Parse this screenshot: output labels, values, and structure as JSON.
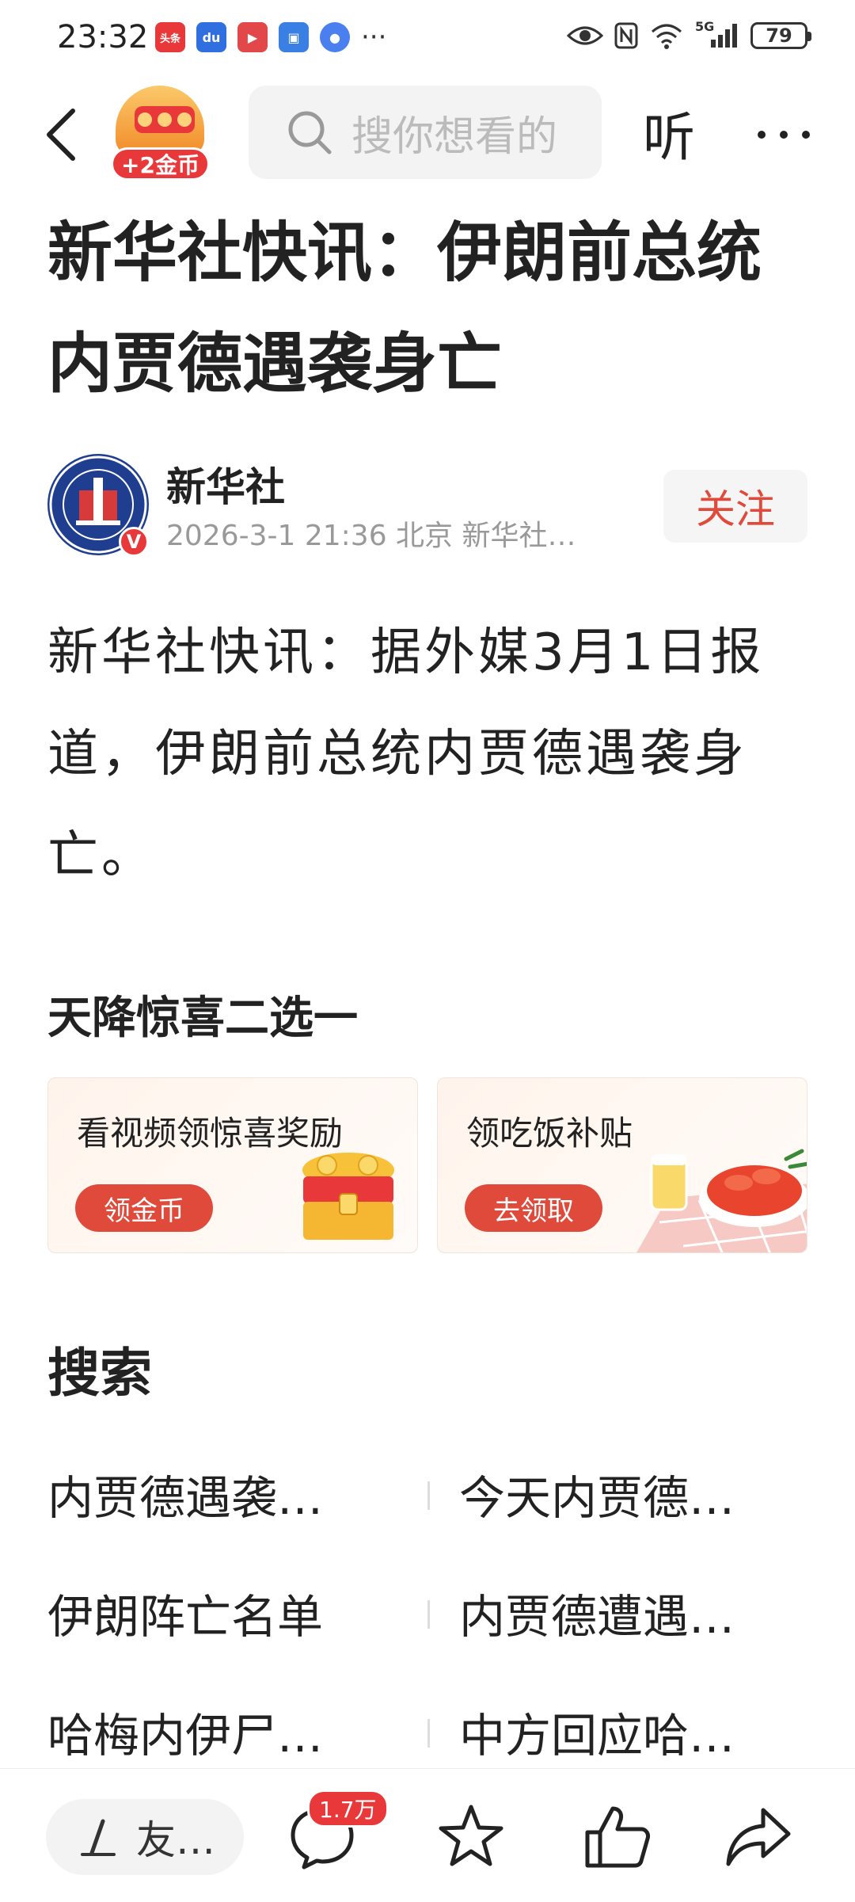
{
  "status_bar": {
    "time": "23:32",
    "app_icons": [
      {
        "name": "toutiao-icon",
        "label": "头条",
        "color": "#e8383a"
      },
      {
        "name": "baidu-icon",
        "label": "du",
        "color": "#2f6fe0"
      },
      {
        "name": "video-icon",
        "label": "▶",
        "color": "#e2484a"
      },
      {
        "name": "phone-icon",
        "label": "▣",
        "color": "#3a7fe4"
      },
      {
        "name": "app-icon",
        "label": "●",
        "color": "#4a7ff0"
      }
    ],
    "more": "···",
    "network": "5G",
    "battery": "79"
  },
  "nav": {
    "coin_badge": "+2金币",
    "search_placeholder": "搜你想看的",
    "listen_label": "听"
  },
  "article": {
    "title": "新华社快讯：伊朗前总统内贾德遇袭身亡",
    "author": {
      "name": "新华社",
      "meta": "2026-3-1  21:36  北京  新华社…",
      "follow_label": "关注",
      "verified_badge": "V"
    },
    "body": "新华社快讯：据外媒3月1日报道，伊朗前总统内贾德遇袭身亡。"
  },
  "promo": {
    "title": "天降惊喜二选一",
    "cards": [
      {
        "title": "看视频领惊喜奖励",
        "button": "领金币"
      },
      {
        "title": "领吃饭补贴",
        "button": "去领取"
      }
    ]
  },
  "search_section": {
    "heading": "搜索",
    "suggestions": [
      [
        "内贾德遇袭…",
        "今天内贾德…"
      ],
      [
        "伊朗阵亡名单",
        "内贾德遭遇…"
      ],
      [
        "哈梅内伊尸…",
        "中方回应哈…"
      ]
    ]
  },
  "bottom_bar": {
    "comment_placeholder": "友…",
    "comment_count": "1.7万"
  },
  "colors": {
    "accent_red": "#e04a3a",
    "text": "#222222",
    "meta_gray": "#999999"
  }
}
